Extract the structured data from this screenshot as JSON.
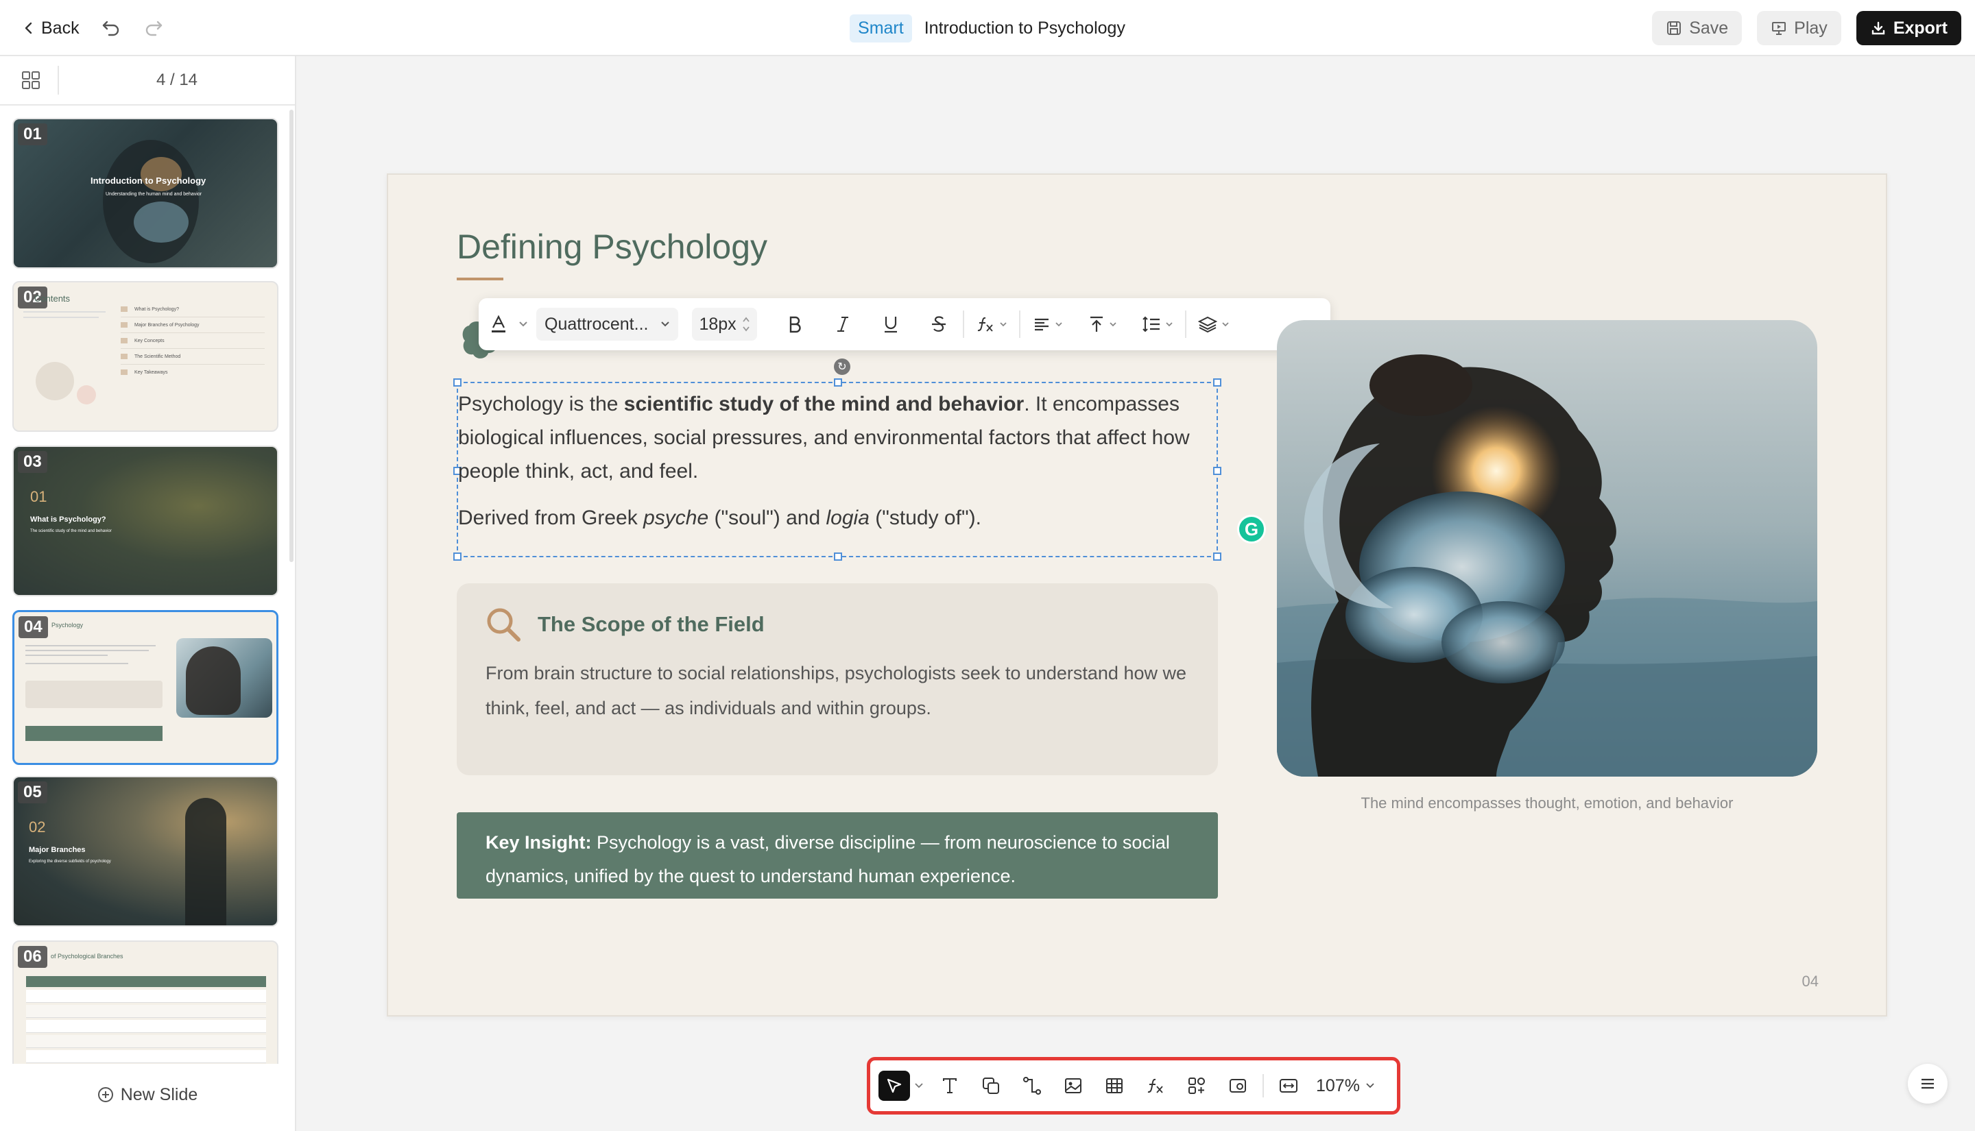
{
  "topbar": {
    "back_label": "Back",
    "badge": "Smart",
    "title": "Introduction to Psychology",
    "save_label": "Save",
    "play_label": "Play",
    "export_label": "Export"
  },
  "sidebar": {
    "page_indicator": "4 / 14",
    "new_slide_label": "New Slide",
    "thumbnails": [
      {
        "num": "01",
        "title": "Introduction to Psychology",
        "subtitle": "Understanding the human mind and behavior"
      },
      {
        "num": "02",
        "title": "Contents",
        "items": [
          "What is Psychology?",
          "Major Branches of Psychology",
          "Key Concepts",
          "The Scientific Method",
          "Key Takeaways"
        ]
      },
      {
        "num": "03",
        "section": "01",
        "title": "What is Psychology?",
        "subtitle": "The scientific study of the mind and behavior"
      },
      {
        "num": "04",
        "title": "Psychology"
      },
      {
        "num": "05",
        "section": "02",
        "title": "Major Branches",
        "subtitle": "Exploring the diverse subfields of psychology"
      },
      {
        "num": "06",
        "title": "of Psychological Branches"
      }
    ]
  },
  "slide": {
    "title": "Defining Psychology",
    "para1_pre": "Psychology is the ",
    "para1_bold": "scientific study of the mind and behavior",
    "para1_post": ". It encompasses biological influences, social pressures, and environmental factors that affect how people think, act, and feel.",
    "para2_pre": "Derived from Greek ",
    "para2_i1": "psyche",
    "para2_mid": " (\"soul\") and ",
    "para2_i2": "logia",
    "para2_post": " (\"study of\").",
    "scope_title": "The Scope of the Field",
    "scope_text": "From brain structure to social relationships, psychologists seek to understand how we think, feel, and act — as individuals and within groups.",
    "insight_label": "Key Insight:",
    "insight_text": " Psychology is a vast, diverse discipline — from neuroscience to social dynamics, unified by the quest to understand human experience.",
    "image_caption": "The mind encompasses thought, emotion, and behavior",
    "page_number": "04"
  },
  "format_toolbar": {
    "font_family": "Quattrocent...",
    "font_size": "18px"
  },
  "bottom_toolbar": {
    "zoom": "107%"
  },
  "colors": {
    "accent_green": "#4f6b5e",
    "accent_tan": "#c0946b",
    "insight_bg": "#5e7b6c",
    "highlight_border": "#e53935",
    "selection_blue": "#4f8fd8"
  }
}
